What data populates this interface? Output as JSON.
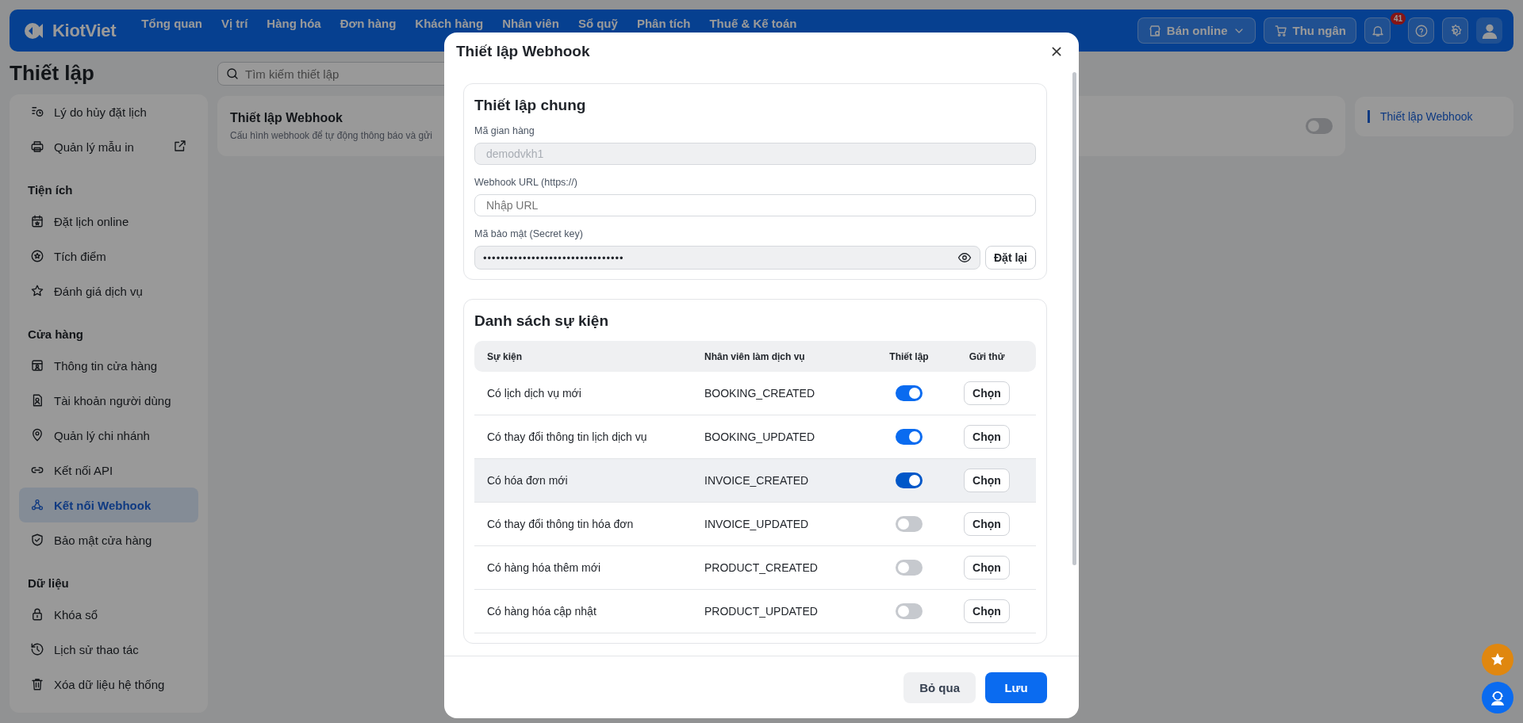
{
  "nav": {
    "logo": "KiotViet",
    "items": [
      "Tổng quan",
      "Vị trí",
      "Hàng hóa",
      "Đơn hàng",
      "Khách hàng",
      "Nhân viên",
      "Sổ quỹ",
      "Phân tích",
      "Thuế & Kế toán"
    ],
    "online_button": "Bán online",
    "cashier_button": "Thu ngân",
    "notification_count": "41"
  },
  "page": {
    "title": "Thiết lập",
    "search_placeholder": "Tìm kiếm thiết lập"
  },
  "sidebar": {
    "groups": [
      {
        "items": [
          {
            "label": "Lý do hủy đặt lịch",
            "selected": false,
            "external_link": false
          },
          {
            "label": "Quản lý mẫu in",
            "selected": false,
            "external_link": true
          }
        ]
      },
      {
        "heading": "Tiện ích",
        "items": [
          {
            "label": "Đặt lịch online",
            "selected": false,
            "external_link": false
          },
          {
            "label": "Tích điểm",
            "selected": false,
            "external_link": false
          },
          {
            "label": "Đánh giá dịch vụ",
            "selected": false,
            "external_link": false
          }
        ]
      },
      {
        "heading": "Cửa hàng",
        "items": [
          {
            "label": "Thông tin cửa hàng",
            "selected": false,
            "external_link": false
          },
          {
            "label": "Tài khoản người dùng",
            "selected": false,
            "external_link": false
          },
          {
            "label": "Quản lý chi nhánh",
            "selected": false,
            "external_link": false
          },
          {
            "label": "Kết nối API",
            "selected": false,
            "external_link": false
          },
          {
            "label": "Kết nối Webhook",
            "selected": true,
            "external_link": false
          },
          {
            "label": "Bảo mật cửa hàng",
            "selected": false,
            "external_link": false
          }
        ]
      },
      {
        "heading": "Dữ liệu",
        "items": [
          {
            "label": "Khóa sổ",
            "selected": false,
            "external_link": false
          },
          {
            "label": "Lịch sử thao tác",
            "selected": false,
            "external_link": false
          },
          {
            "label": "Xóa dữ liệu hệ thống",
            "selected": false,
            "external_link": false
          }
        ]
      }
    ]
  },
  "content": {
    "title": "Thiết lập Webhook",
    "subtitle": "Cấu hình webhook để tự động thông báo và gửi",
    "on": false
  },
  "toc": {
    "items": [
      {
        "label": "Thiết lập Webhook",
        "selected": true
      }
    ]
  },
  "modal": {
    "title": "Thiết lập Webhook",
    "general": {
      "title": "Thiết lập chung",
      "store_code_label": "Mã gian hàng",
      "store_code_value": "demodvkh1",
      "url_label": "Webhook URL (https://)",
      "url_placeholder": "Nhập URL",
      "secret_label": "Mã bảo mật (Secret key)",
      "secret_value": "••••••••••••••••••••••••••••••••",
      "reset_button": "Đặt lại"
    },
    "events": {
      "title": "Danh sách sự kiện",
      "columns": [
        "Sự kiện",
        "Nhân viên làm dịch vụ",
        "Thiết lập",
        "Gửi thử"
      ],
      "rows": [
        {
          "event": "Có lịch dịch vụ mới",
          "code": "BOOKING_CREATED",
          "on": true,
          "hovered": false,
          "button": "Chọn"
        },
        {
          "event": "Có thay đổi thông tin lịch dịch vụ",
          "code": "BOOKING_UPDATED",
          "on": true,
          "hovered": false,
          "button": "Chọn"
        },
        {
          "event": "Có hóa đơn mới",
          "code": "INVOICE_CREATED",
          "on": true,
          "hovered": true,
          "button": "Chọn"
        },
        {
          "event": "Có thay đổi thông tin hóa đơn",
          "code": "INVOICE_UPDATED",
          "on": false,
          "hovered": false,
          "button": "Chọn"
        },
        {
          "event": "Có hàng hóa thêm mới",
          "code": "PRODUCT_CREATED",
          "on": false,
          "hovered": false,
          "button": "Chọn"
        },
        {
          "event": "Có hàng hóa cập nhật",
          "code": "PRODUCT_UPDATED",
          "on": false,
          "hovered": false,
          "button": "Chọn"
        }
      ]
    },
    "cancel_button": "Bỏ qua",
    "save_button": "Lưu"
  }
}
